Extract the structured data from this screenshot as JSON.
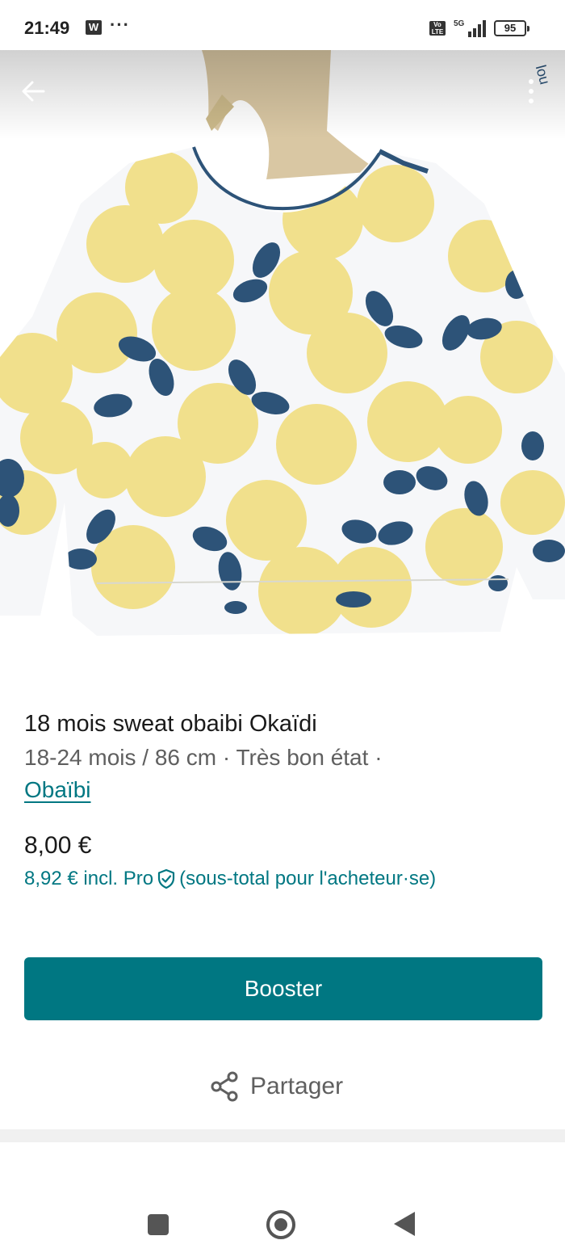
{
  "status": {
    "time": "21:49",
    "app_badge": "W",
    "more": "···",
    "network": "5G",
    "battery": "95"
  },
  "product": {
    "title": "18 mois sweat obaibi Okaïdi",
    "details": "18-24 mois / 86 cm · Très bon état ·",
    "brand": "Obaïbi",
    "price": "8,00 €",
    "price_incl": "8,92 € incl. Pro",
    "price_note": "(sous-total pour l'acheteur·se)"
  },
  "actions": {
    "booster_label": "Booster",
    "share_label": "Partager"
  },
  "colors": {
    "accent": "#007782",
    "lemon_yellow": "#f1e08c",
    "leaf_blue": "#2d5378"
  },
  "icons": {
    "back": "arrow-left-icon",
    "more": "more-vertical-icon",
    "shield": "shield-check-icon",
    "share": "share-icon"
  }
}
